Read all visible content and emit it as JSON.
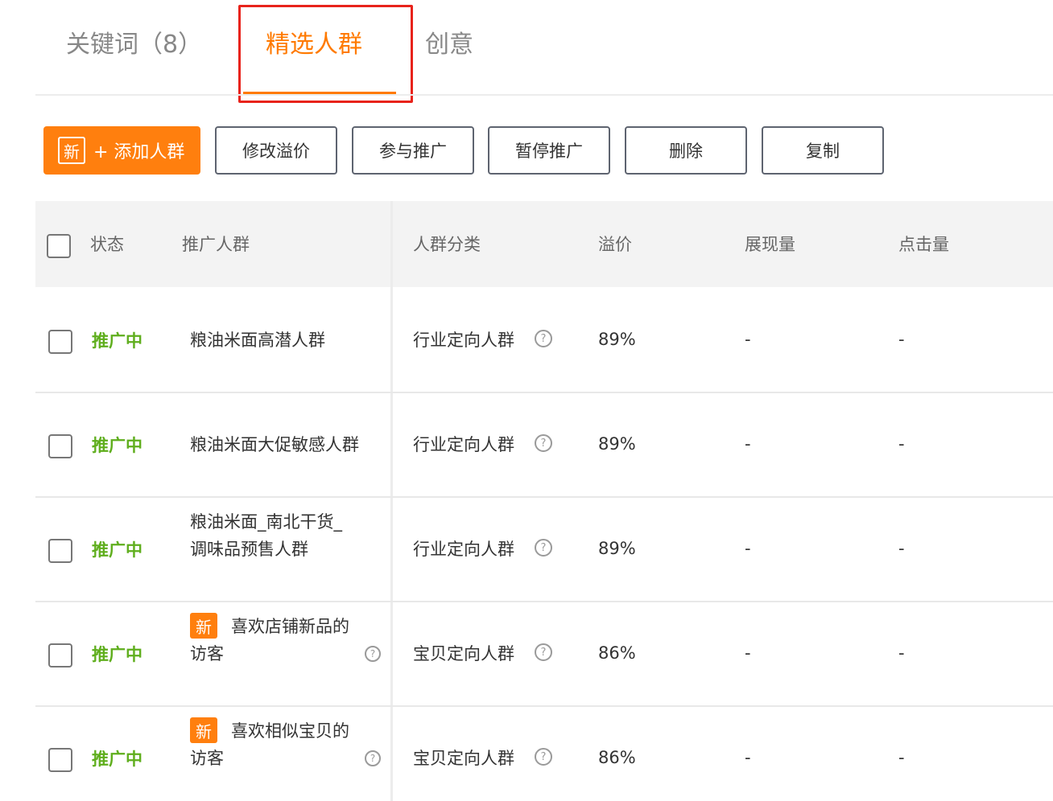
{
  "tabs": [
    {
      "label": "关键词（8）"
    },
    {
      "label": "精选人群"
    },
    {
      "label": "创意"
    }
  ],
  "toolbar": {
    "add_badge": "新",
    "add_label": "+ 添加人群",
    "modify_bid": "修改溢价",
    "join_promo": "参与推广",
    "pause_promo": "暂停推广",
    "delete": "删除",
    "copy": "复制"
  },
  "table": {
    "headers": {
      "status": "状态",
      "audience": "推广人群",
      "category": "人群分类",
      "premium": "溢价",
      "impressions": "展现量",
      "clicks": "点击量"
    },
    "rows": [
      {
        "status": "推广中",
        "name_line1": "粮油米面高潜人群",
        "name_line2": "",
        "category": "行业定向人群",
        "premium": "89%",
        "impressions": "-",
        "clicks": "-"
      },
      {
        "status": "推广中",
        "name_line1": "粮油米面大促敏感人群",
        "name_line2": "",
        "category": "行业定向人群",
        "premium": "89%",
        "impressions": "-",
        "clicks": "-"
      },
      {
        "status": "推广中",
        "name_line1": "粮油米面_南北干货_",
        "name_line2": "调味品预售人群",
        "category": "行业定向人群",
        "premium": "89%",
        "impressions": "-",
        "clicks": "-"
      },
      {
        "status": "推广中",
        "badge": "新",
        "name_line1": "喜欢店铺新品的",
        "name_line2": "访客",
        "category": "宝贝定向人群",
        "premium": "86%",
        "impressions": "-",
        "clicks": "-"
      },
      {
        "status": "推广中",
        "badge": "新",
        "name_line1": "喜欢相似宝贝的",
        "name_line2": "访客",
        "category": "宝贝定向人群",
        "premium": "86%",
        "impressions": "-",
        "clicks": "-"
      }
    ]
  },
  "icons": {
    "help": "question-circle-icon",
    "checkbox": "checkbox-icon"
  },
  "colors": {
    "accent": "#ff7a00",
    "status_active": "#5fae1d",
    "highlight": "#e8231b"
  }
}
